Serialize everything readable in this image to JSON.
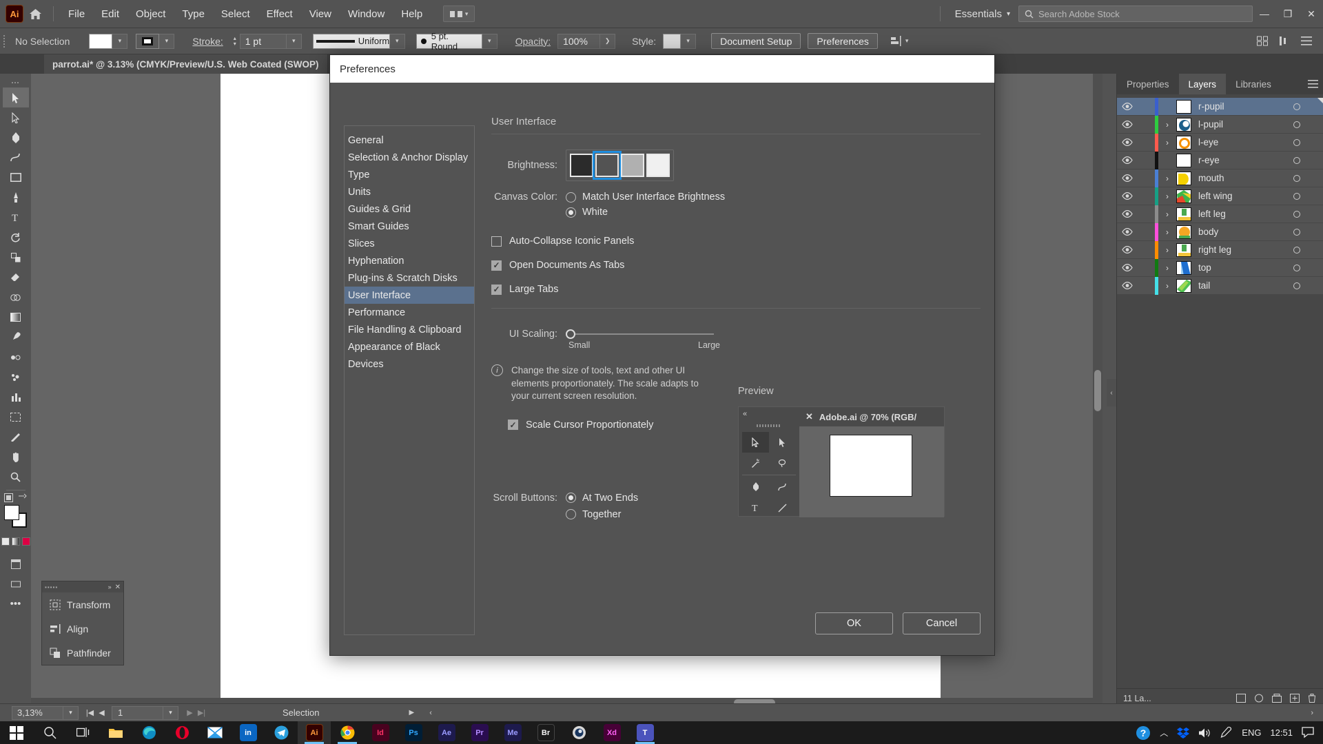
{
  "menubar": {
    "app_badge": "Ai",
    "items": [
      "File",
      "Edit",
      "Object",
      "Type",
      "Select",
      "Effect",
      "View",
      "Window",
      "Help"
    ],
    "workspace": "Essentials",
    "search_placeholder": "Search Adobe Stock"
  },
  "controlbar": {
    "selection_status": "No Selection",
    "stroke_label": "Stroke:",
    "stroke_weight": "1 pt",
    "profile": "Uniform",
    "brush": "5 pt. Round",
    "opacity_label": "Opacity:",
    "opacity_value": "100%",
    "style_label": "Style:",
    "document_setup": "Document Setup",
    "preferences": "Preferences"
  },
  "document": {
    "tab_title": "parrot.ai* @ 3.13% (CMYK/Preview/U.S. Web Coated (SWOP)"
  },
  "floating_panel": {
    "items": [
      {
        "label": "Transform",
        "icon": "transform-icon"
      },
      {
        "label": "Align",
        "icon": "align-icon"
      },
      {
        "label": "Pathfinder",
        "icon": "pathfinder-icon"
      }
    ]
  },
  "right_panel": {
    "tabs": [
      "Properties",
      "Layers",
      "Libraries"
    ],
    "active_tab": "Layers",
    "layers": [
      {
        "name": "r-pupil",
        "color": "#3a5fcd",
        "selected": true,
        "expandable": false,
        "thumb": "blank"
      },
      {
        "name": "l-pupil",
        "color": "#2ecc40",
        "selected": false,
        "expandable": true,
        "thumb": "pupil"
      },
      {
        "name": "l-eye",
        "color": "#ff5b4d",
        "selected": false,
        "expandable": true,
        "thumb": "eye"
      },
      {
        "name": "r-eye",
        "color": "#111111",
        "selected": false,
        "expandable": false,
        "thumb": "blank"
      },
      {
        "name": "mouth",
        "color": "#4a7fd4",
        "selected": false,
        "expandable": true,
        "thumb": "mouth"
      },
      {
        "name": "left wing",
        "color": "#16a085",
        "selected": false,
        "expandable": true,
        "thumb": "wing"
      },
      {
        "name": "left leg",
        "color": "#8c8c8c",
        "selected": false,
        "expandable": true,
        "thumb": "leg"
      },
      {
        "name": "body",
        "color": "#ff4fdc",
        "selected": false,
        "expandable": true,
        "thumb": "body"
      },
      {
        "name": "right leg",
        "color": "#ff8c00",
        "selected": false,
        "expandable": true,
        "thumb": "leg"
      },
      {
        "name": "top",
        "color": "#117a11",
        "selected": false,
        "expandable": true,
        "thumb": "top"
      },
      {
        "name": "tail",
        "color": "#45e0e8",
        "selected": false,
        "expandable": true,
        "thumb": "tail"
      }
    ],
    "footer_count": "11 La..."
  },
  "statusbar": {
    "zoom": "3,13%",
    "page": "1",
    "tool_status": "Selection"
  },
  "dialog": {
    "title": "Preferences",
    "categories": [
      "General",
      "Selection & Anchor Display",
      "Type",
      "Units",
      "Guides & Grid",
      "Smart Guides",
      "Slices",
      "Hyphenation",
      "Plug-ins & Scratch Disks",
      "User Interface",
      "Performance",
      "File Handling & Clipboard",
      "Appearance of Black",
      "Devices"
    ],
    "selected_category": "User Interface",
    "panel_title": "User Interface",
    "brightness": {
      "label": "Brightness:",
      "swatches": [
        "#2b2b2b",
        "#535353",
        "#b0b0b0",
        "#f0f0f0"
      ],
      "selected_index": 1
    },
    "canvas_color": {
      "label": "Canvas Color:",
      "options": [
        {
          "label": "Match User Interface Brightness",
          "selected": false
        },
        {
          "label": "White",
          "selected": true
        }
      ]
    },
    "checkboxes": [
      {
        "label": "Auto-Collapse Iconic Panels",
        "checked": false
      },
      {
        "label": "Open Documents As Tabs",
        "checked": true
      },
      {
        "label": "Large Tabs",
        "checked": true
      }
    ],
    "ui_scaling": {
      "label": "UI Scaling:",
      "min_label": "Small",
      "max_label": "Large",
      "value_percent": 0,
      "info": "Change the size of tools, text and other UI elements proportionately. The scale adapts to your current screen resolution.",
      "scale_cursor": {
        "label": "Scale Cursor Proportionately",
        "checked": true
      }
    },
    "preview": {
      "title": "Preview",
      "doc_tab": "Adobe.ai @ 70% (RGB/"
    },
    "scroll_buttons": {
      "label": "Scroll Buttons:",
      "options": [
        {
          "label": "At Two Ends",
          "selected": true
        },
        {
          "label": "Together",
          "selected": false
        }
      ]
    },
    "ok_label": "OK",
    "cancel_label": "Cancel"
  },
  "taskbar": {
    "apps": [
      {
        "name": "start-icon",
        "label": "",
        "bg": "transparent"
      },
      {
        "name": "search-icon",
        "label": "",
        "bg": "transparent"
      },
      {
        "name": "taskview-icon",
        "label": "",
        "bg": "transparent"
      },
      {
        "name": "explorer-icon",
        "label": "",
        "bg": "transparent"
      },
      {
        "name": "edge-icon",
        "label": "",
        "bg": "transparent"
      },
      {
        "name": "opera-icon",
        "label": "",
        "bg": "transparent"
      },
      {
        "name": "mail-icon",
        "label": "",
        "bg": "transparent"
      },
      {
        "name": "linkedin-icon",
        "label": "in",
        "bg": "#0a66c2"
      },
      {
        "name": "telegram-icon",
        "label": "",
        "bg": "transparent"
      },
      {
        "name": "illustrator-icon",
        "label": "Ai",
        "bg": "#330000"
      },
      {
        "name": "chrome-icon",
        "label": "",
        "bg": "transparent"
      },
      {
        "name": "indesign-icon",
        "label": "Id",
        "bg": "#49021f"
      },
      {
        "name": "photoshop-icon",
        "label": "Ps",
        "bg": "#001e36"
      },
      {
        "name": "aftereffects-icon",
        "label": "Ae",
        "bg": "#1d1a4d"
      },
      {
        "name": "premiere-icon",
        "label": "Pr",
        "bg": "#2a0d50"
      },
      {
        "name": "media-encoder-icon",
        "label": "Me",
        "bg": "#1d1a4d"
      },
      {
        "name": "bridge-icon",
        "label": "Br",
        "bg": "#1a1a1a"
      },
      {
        "name": "cinema4d-icon",
        "label": "",
        "bg": "transparent"
      },
      {
        "name": "xd-icon",
        "label": "Xd",
        "bg": "#470137"
      },
      {
        "name": "teams-icon",
        "label": "T",
        "bg": "#4b53bc"
      }
    ],
    "tray": {
      "language": "ENG",
      "clock": "12:51"
    }
  },
  "colors": {
    "accent_blue": "#1f8fe0",
    "selection_blue": "#5b718e",
    "panel_gray": "#535353",
    "dark_gray": "#474747"
  }
}
